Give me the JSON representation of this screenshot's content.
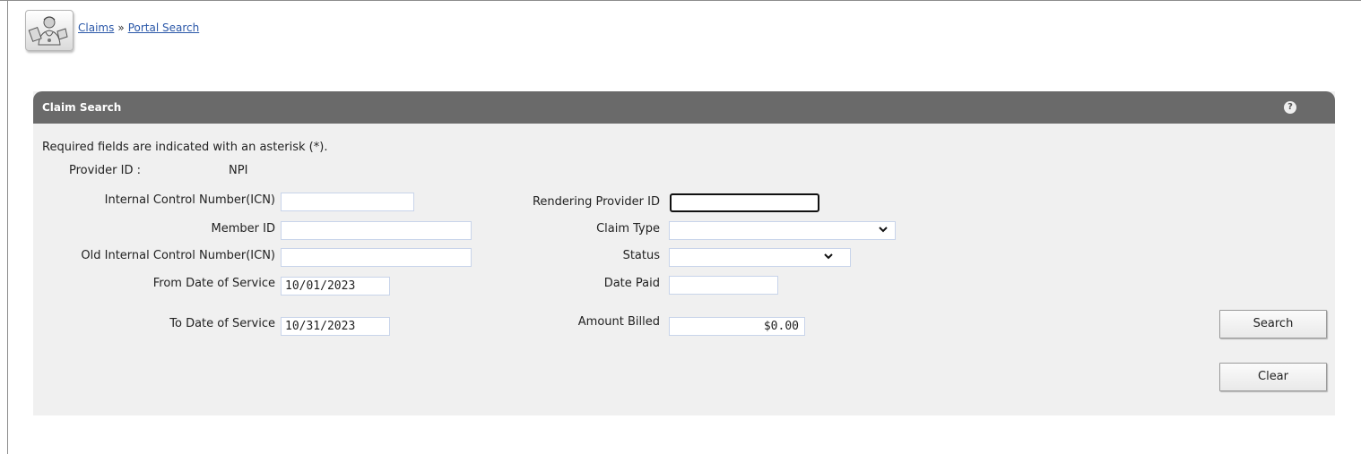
{
  "breadcrumb": {
    "items": [
      "Claims",
      "Portal Search"
    ],
    "separator": "»"
  },
  "panel": {
    "title": "Claim Search",
    "help_icon": "?",
    "required_note": "Required fields are indicated with an asterisk (*).",
    "provider_label": "Provider ID :",
    "provider_suffix": "NPI"
  },
  "left_fields": {
    "icn_label": "Internal Control Number(ICN)",
    "icn_value": "",
    "member_label": "Member ID",
    "member_value": "",
    "old_icn_label": "Old Internal Control Number(ICN)",
    "old_icn_value": "",
    "from_dos_label": "From Date of Service",
    "from_dos_value": "10/01/2023",
    "to_dos_label": "To Date of Service",
    "to_dos_value": "10/31/2023"
  },
  "right_fields": {
    "rendering_label": "Rendering Provider ID",
    "rendering_value": "",
    "claim_type_label": "Claim Type",
    "claim_type_value": "",
    "status_label": "Status",
    "status_value": "",
    "date_paid_label": "Date Paid",
    "date_paid_value": "",
    "amount_label": "Amount Billed",
    "amount_value": "$0.00"
  },
  "buttons": {
    "search": "Search",
    "clear": "Clear"
  },
  "icons": {
    "logo": "doctor-portal-logo-icon",
    "dropdown": "chevron-down-icon",
    "help": "help-icon"
  }
}
